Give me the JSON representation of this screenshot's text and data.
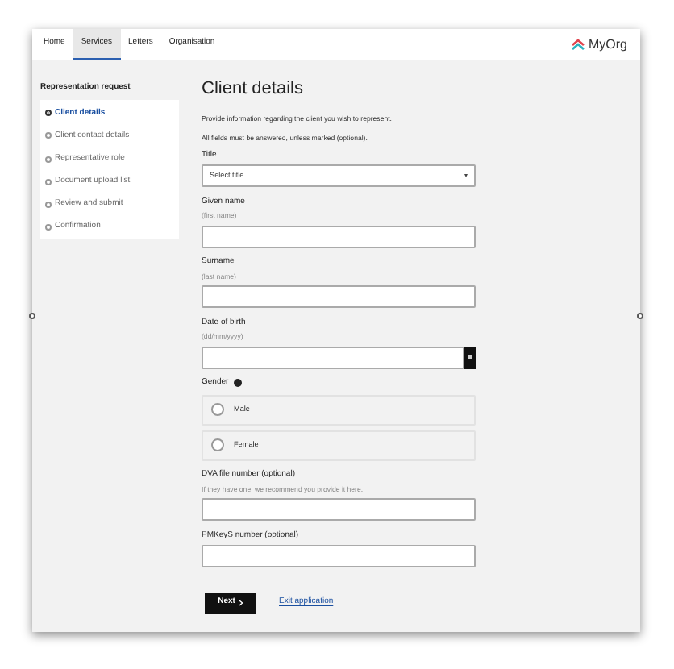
{
  "nav": {
    "tabs": [
      {
        "label": "Home",
        "selected": false
      },
      {
        "label": "Services",
        "selected": true
      },
      {
        "label": "Letters",
        "selected": false
      },
      {
        "label": "Organisation",
        "selected": false
      }
    ],
    "logo": "MyOrg"
  },
  "sidebar": {
    "title": "Representation request",
    "steps": [
      {
        "label": "Client details",
        "selected": true
      },
      {
        "label": "Client contact details",
        "selected": false
      },
      {
        "label": "Representative role",
        "selected": false
      },
      {
        "label": "Document upload list",
        "selected": false
      },
      {
        "label": "Review and submit",
        "selected": false
      },
      {
        "label": "Confirmation",
        "selected": false
      }
    ]
  },
  "form": {
    "title": "Client details",
    "intro": [
      "Provide information regarding the client you wish to represent.",
      "All fields must be answered, unless marked (optional)."
    ],
    "fields": [
      {
        "kind": "select",
        "label": "Title",
        "placeholder": "Select title"
      },
      {
        "kind": "text",
        "label": "Given name",
        "hint": "(first name)"
      },
      {
        "kind": "text",
        "label": "Surname",
        "hint": "(last name)"
      },
      {
        "kind": "date",
        "label": "Date of birth",
        "hint": "(dd/mm/yyyy)"
      },
      {
        "kind": "radio",
        "label": "Gender",
        "options": [
          {
            "label": "Male",
            "selected": false
          },
          {
            "label": "Female",
            "selected": false
          }
        ]
      },
      {
        "kind": "text",
        "label": "DVA file number (optional)",
        "hint": "If they have one, we recommend you provide it here."
      },
      {
        "kind": "text",
        "label": "PMKeyS number (optional)"
      }
    ],
    "next_button": "Next",
    "exit_link": "Exit application"
  }
}
